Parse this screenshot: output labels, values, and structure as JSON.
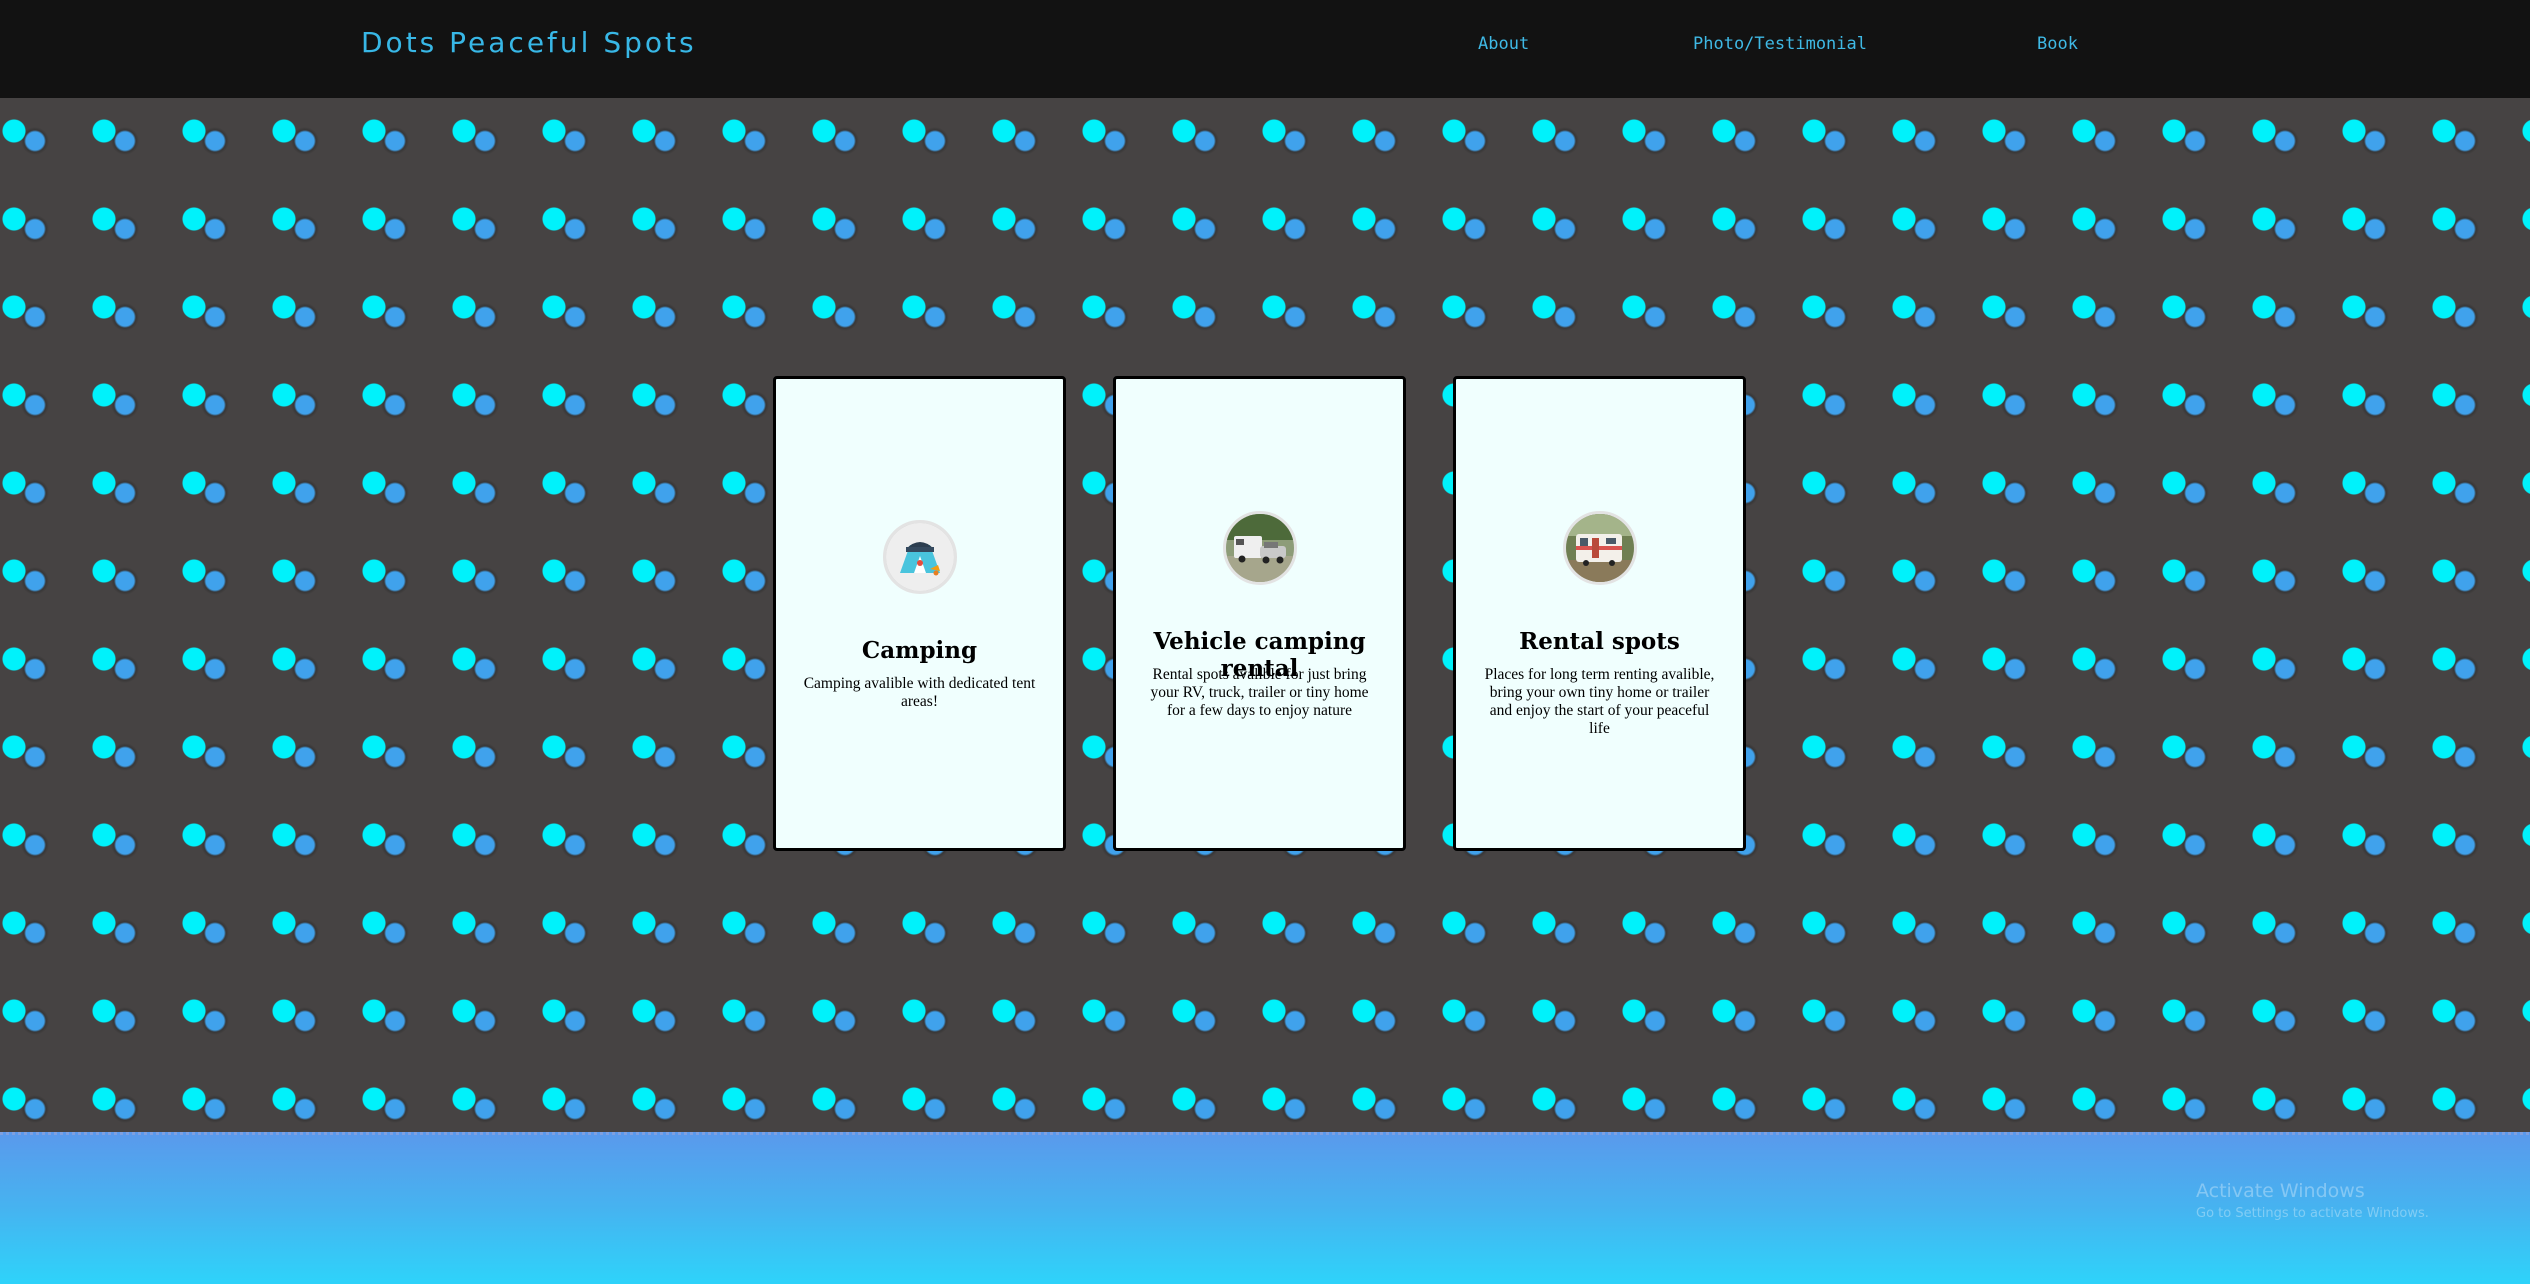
{
  "header": {
    "brand": "Dots Peaceful Spots",
    "nav": [
      {
        "label": "About"
      },
      {
        "label": "Photo/Testimonial"
      },
      {
        "label": "Book"
      }
    ]
  },
  "cards": [
    {
      "title": "Camping",
      "text": "Camping avalible with dedicated tent areas!",
      "icon": "tent-camping-icon"
    },
    {
      "title": "Vehicle camping rental",
      "text": "Rental spots avalible for just bring your RV, truck, trailer or tiny home for a few days to enjoy nature",
      "icon": "rv-vehicle-photo"
    },
    {
      "title": "Rental spots",
      "text": "Places for long term renting avalible, bring your own tiny home or trailer and enjoy the start of your peaceful life",
      "icon": "rental-trailer-photo"
    }
  ],
  "watermark": {
    "line1": "Activate Windows",
    "line2": "Go to Settings to activate Windows."
  },
  "colors": {
    "header_bg": "#121212",
    "brand": "#38b7e6",
    "dot_primary": "#00f2fb",
    "dot_secondary": "#40a2ec",
    "page_bg": "#464343",
    "card_bg": "#f0fffe"
  }
}
